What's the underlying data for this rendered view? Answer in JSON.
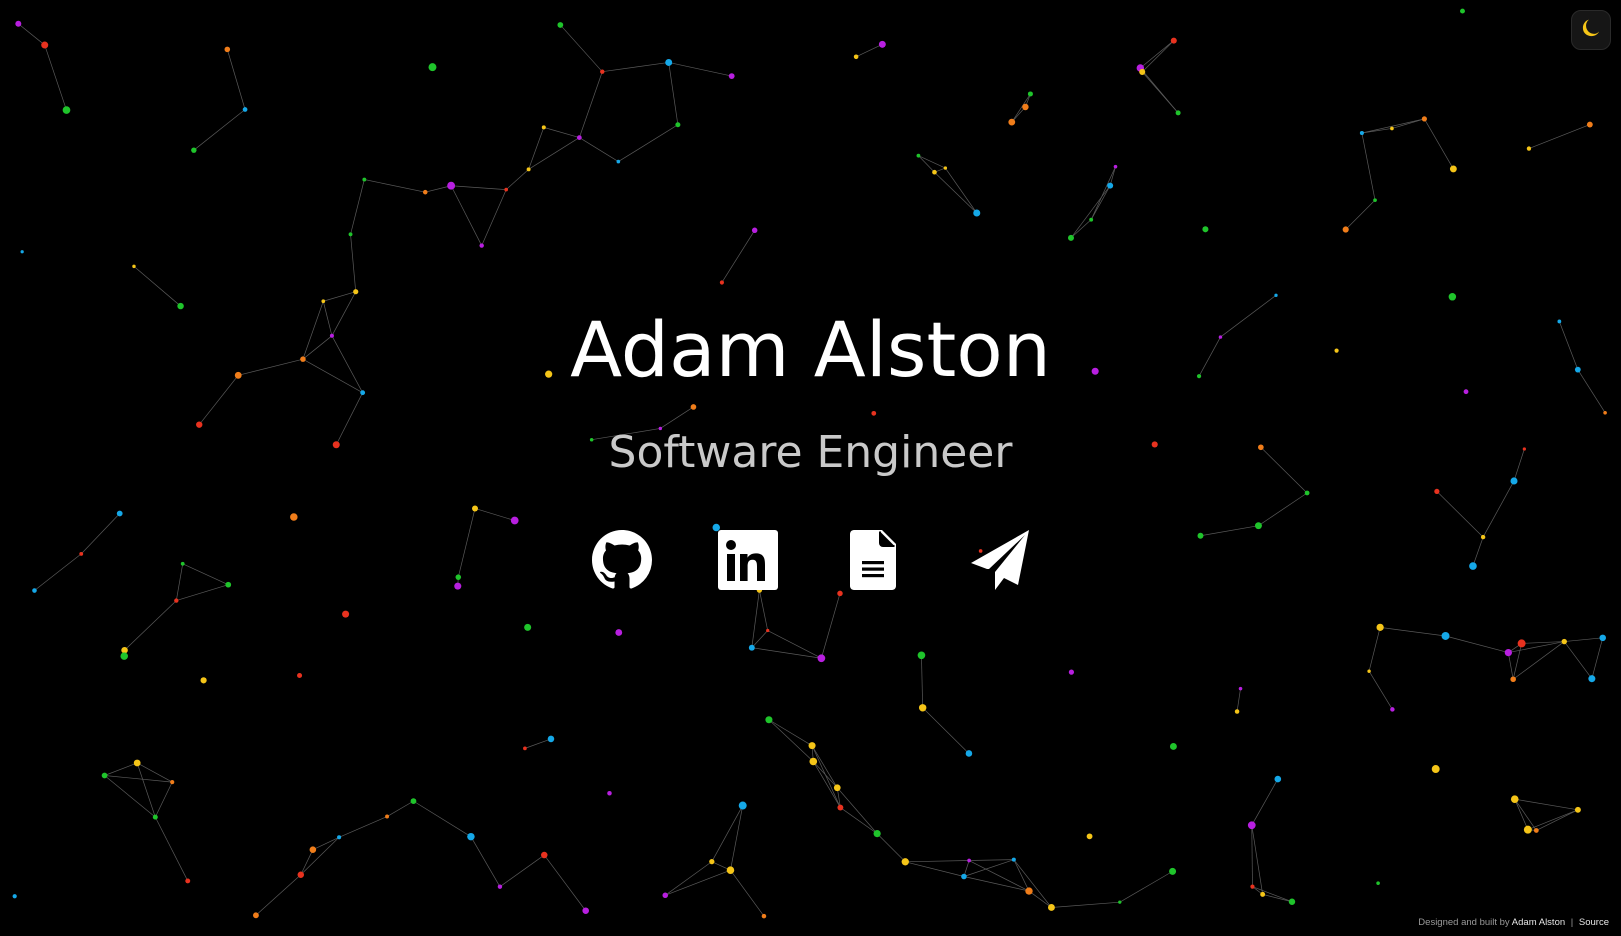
{
  "hero": {
    "name": "Adam Alston",
    "role": "Software Engineer"
  },
  "social": [
    {
      "name": "github",
      "icon": "github-icon"
    },
    {
      "name": "linkedin",
      "icon": "linkedin-icon"
    },
    {
      "name": "resume",
      "icon": "document-icon"
    },
    {
      "name": "contact",
      "icon": "paper-plane-icon"
    }
  ],
  "theme_toggle": {
    "icon": "moon-icon",
    "color": "#f5c518"
  },
  "footer": {
    "prefix": "Designed and built by",
    "author_link": "Adam Alston",
    "separator": "|",
    "source_link": "Source"
  },
  "colors": {
    "background": "#000000",
    "name_text": "#ffffff",
    "role_text": "#c9c9c9",
    "particle_palette": [
      "#e8321f",
      "#f07d1a",
      "#f5c518",
      "#1fc42b",
      "#15a8e8",
      "#b81fe0"
    ]
  }
}
